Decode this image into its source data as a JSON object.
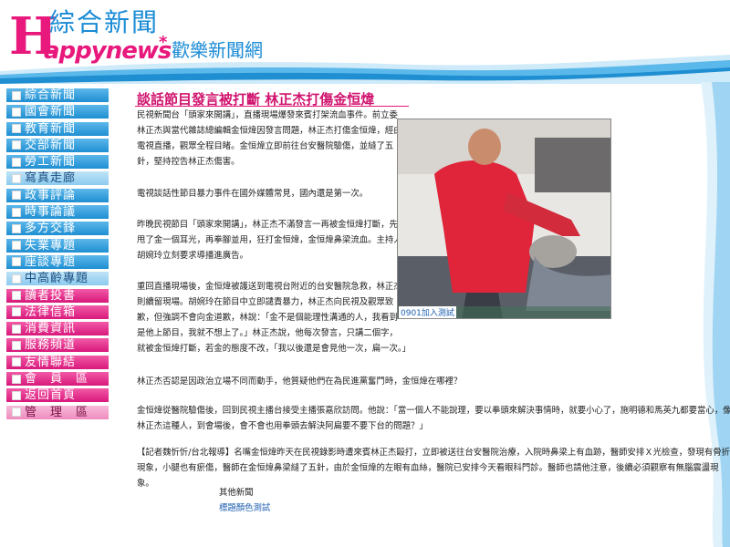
{
  "header": {
    "logo_zh": "綜合新聞",
    "logo_h": "H",
    "logo_appy": "appynews",
    "logo_star": "*",
    "logo_sub": "歡樂新聞網"
  },
  "nav": [
    {
      "label": "綜合新聞",
      "style": "blue"
    },
    {
      "label": "國會新聞",
      "style": "blue"
    },
    {
      "label": "教育新聞",
      "style": "blue"
    },
    {
      "label": "交部新聞",
      "style": "blue"
    },
    {
      "label": "勞工新聞",
      "style": "blue"
    },
    {
      "label": "寫真走廊",
      "style": "light"
    },
    {
      "label": "政事評論",
      "style": "blue"
    },
    {
      "label": "時事論議",
      "style": "blue"
    },
    {
      "label": "多方交鋒",
      "style": "blue"
    },
    {
      "label": "失業專題",
      "style": "blue"
    },
    {
      "label": "座談專題",
      "style": "blue"
    },
    {
      "label": "中高齡專題",
      "style": "light"
    },
    {
      "label": "讀者投書",
      "style": "pink"
    },
    {
      "label": "法律信箱",
      "style": "pink"
    },
    {
      "label": "消費資訊",
      "style": "pink"
    },
    {
      "label": "服務頻道",
      "style": "pink"
    },
    {
      "label": "友情聯結",
      "style": "pink"
    },
    {
      "label": "會　員　區",
      "style": "pink"
    },
    {
      "label": "返回首頁",
      "style": "pink"
    },
    {
      "label": "管　理　區",
      "style": "lightpink"
    }
  ],
  "article": {
    "title": "談話節目發言被打斷 林正杰打傷金恒煒",
    "p1": [
      "民視新聞台「頭家來開講」，直播現場爆發來賓打架流血事件。前立委",
      "林正杰與當代雜誌總編輯金恒煒因發言問題，林正杰打傷金恒煒，經由",
      "電視直播，觀眾全程目睹。金恒煒立即前往台安醫院驗傷，並縫了五",
      "針，堅持控告林正杰傷害。"
    ],
    "p2": [
      "電視談話性節目暴力事件在國外媒體常見，國內還是第一次。"
    ],
    "p3": [
      "昨晚民視節目「頭家來開講」，林正杰不滿發言一再被金恒煒打斷，先",
      "甩了金一個耳光，再拳腳並用，狂打金恒煒，金恒煒鼻梁流血。主持人",
      "胡婉玲立刻要求導播進廣告。"
    ],
    "p4": [
      "重回直播現場後，金恒煒被護送到電視台附近的台安醫院急救，林正杰",
      "則續留現場。胡婉玲在節目中立即譴責暴力，林正杰向民視及觀眾致",
      "歉，但強調不會向金道歉，林說：「金不是個能理性溝通的人，我看到",
      "是他上節目，我就不想上了。」林正杰說，他每次發言，只講二個字，",
      "就被金恒煒打斷，若金的態度不改，「我以後還是會見他一次，扁一次。」"
    ],
    "p5": [
      "林正杰否認是因政治立場不同而動手，他質疑他們在為民進黨奮鬥時，金恒煒在哪裡？"
    ],
    "p6": [
      "金恒煒從醫院驗傷後，回到民視主播台接受主播張嘉欣訪問。他說：「當一個人不能說理，要以拳頭來解決事情時，就要小心了，施明德和馬英九都要當心，像",
      "林正杰這種人，到會場後，會不會也用拳頭去解決阿扁要不要下台的問題？」"
    ],
    "p7": [
      "【記者魏忻忻/台北報導】名嘴金恒煒昨天在民視錄影時遭來賓林正杰毆打，立即被送往台安醫院治療，入院時鼻梁上有血跡，醫師安排Ｘ光檢查，發現有骨折",
      "現象，小腿也有瘀傷，醫師在金恒煒鼻梁縫了五針，由於金恒煒的左眼有血絲，醫院已安排今天看眼科門診。醫師也請他注意，後續必須觀察有無腦震盪現",
      "象。"
    ],
    "photo_caption": "0901加入測試",
    "other_news_label": "其他新聞",
    "other_news_link": "標題顏色測試"
  }
}
